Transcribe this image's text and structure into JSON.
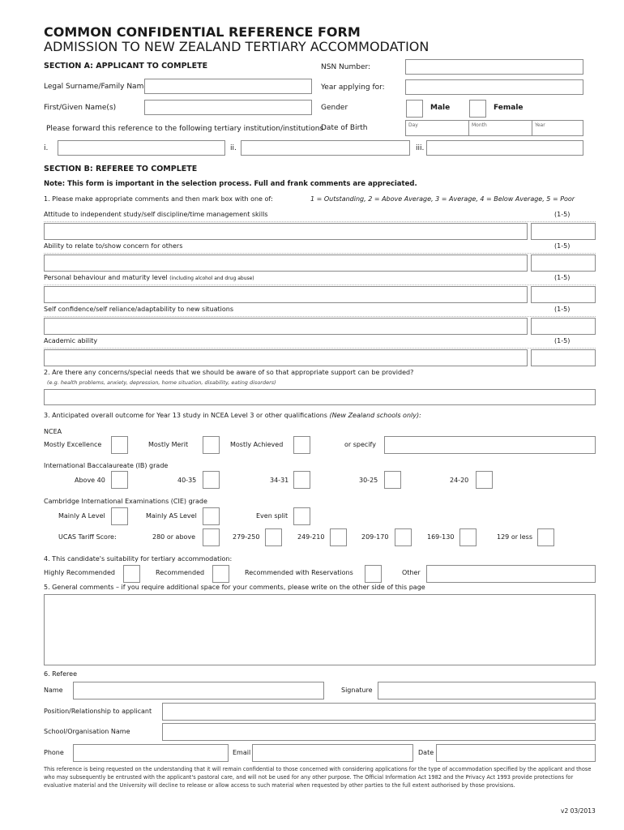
{
  "header": {
    "title": "COMMON CONFIDENTIAL REFERENCE FORM",
    "subtitle": "ADMISSION TO NEW ZEALAND TERTIARY ACCOMMODATION"
  },
  "section_a": {
    "heading": "SECTION A: APPLICANT TO COMPLETE",
    "surname_label": "Legal Surname/Family Name",
    "given_label": "First/Given Name(s)",
    "forward_label": "Please forward this reference to the following tertiary institution/institutions",
    "nsn_label": "NSN Number:",
    "year_label": "Year applying for:",
    "gender_label": "Gender",
    "male_label": "Male",
    "female_label": "Female",
    "dob_label": "Date of Birth",
    "dob_day": "Day",
    "dob_month": "Month",
    "dob_year": "Year",
    "inst_i": "i.",
    "inst_ii": "ii.",
    "inst_iii": "iii."
  },
  "section_b": {
    "heading": "SECTION B: REFEREE TO COMPLETE",
    "note": "Note: This form is important in the selection process. Full and frank comments are appreciated.",
    "q1": "1. Please make appropriate comments and then mark box with one of:",
    "q1_scale": "1 = Outstanding, 2 = Above Average, 3 = Average, 4 = Below Average, 5 = Poor",
    "rating_label": "(1-5)",
    "criteria": [
      {
        "label": "Attitude to independent study/self discipline/time management skills",
        "note": ""
      },
      {
        "label": "Ability to relate to/show concern for others",
        "note": ""
      },
      {
        "label": "Personal behaviour and maturity level",
        "note": "(including alcohol and drug abuse)"
      },
      {
        "label": "Self confidence/self reliance/adaptability to new situations",
        "note": ""
      },
      {
        "label": "Academic ability",
        "note": ""
      }
    ],
    "q2": "2. Are there any concerns/special needs that we should be aware of so that appropriate support can be provided?",
    "q2_hint": "(e.g. health problems, anxiety, depression, home situation, disability, eating disorders)",
    "q3": "3. Anticipated overall outcome for Year 13 study in NCEA Level 3 or other qualifications",
    "q3_note": "(New Zealand schools only):",
    "ncea": {
      "heading": "NCEA",
      "options": [
        "Mostly Excellence",
        "Mostly Merit",
        "Mostly Achieved"
      ],
      "specify_label": "or specify"
    },
    "ib": {
      "heading": "International Baccalaureate (IB) grade",
      "options": [
        "Above 40",
        "40-35",
        "34-31",
        "30-25",
        "24-20"
      ]
    },
    "cie": {
      "heading": "Cambridge International Examinations (CIE) grade",
      "options": [
        "Mainly A Level",
        "Mainly AS Level",
        "Even split"
      ],
      "ucas_label": "UCAS Tariff Score:",
      "ucas_options": [
        "280 or above",
        "279-250",
        "249-210",
        "209-170",
        "169-130",
        "129 or less"
      ]
    },
    "q4": "4. This candidate's suitability for tertiary accommodation:",
    "q4_options": [
      "Highly Recommended",
      "Recommended",
      "Recommended with Reservations"
    ],
    "q4_other": "Other",
    "q5": "5. General comments – if you require additional space for your comments, please write on the other side of this page",
    "q6": "6. Referee",
    "referee": {
      "name_label": "Name",
      "signature_label": "Signature",
      "position_label": "Position/Relationship to applicant",
      "school_label": "School/Organisation Name",
      "phone_label": "Phone",
      "email_label": "Email",
      "date_label": "Date"
    }
  },
  "footer": {
    "disclaimer": "This reference is being requested on the understanding that it will remain confidential to those concerned with considering applications for the type of accommodation specified by the applicant and those who may subsequently be entrusted with the applicant's pastoral care, and will not be used for any other purpose. The Official Information Act 1982 and the Privacy Act 1993 provide protections for evaluative material and the University will decline to release or allow access to such material when requested by other parties to the full extent authorised by those provisions.",
    "version": "v2 03/2013"
  }
}
